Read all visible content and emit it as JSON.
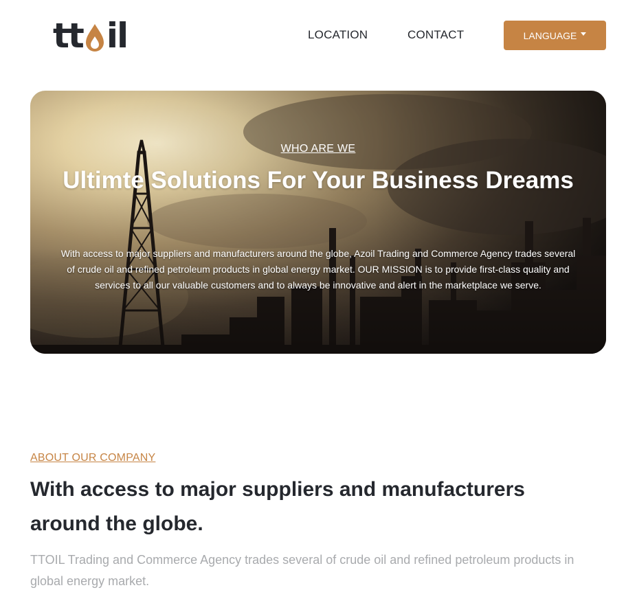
{
  "header": {
    "logo": {
      "text_left": "tt",
      "text_right": "il",
      "drop_icon": "oil-drop-icon"
    },
    "nav": [
      {
        "label": "LOCATION"
      },
      {
        "label": "CONTACT"
      }
    ],
    "language_button": {
      "label": "LANGUAGE"
    }
  },
  "hero": {
    "eyebrow": "WHO ARE WE",
    "title": "Ultimte Solutions For Your Business Dreams",
    "text": "With access to major suppliers and manufacturers around the globe, Azoil Trading and Commerce Agency trades several of crude oil and refined petroleum products in global energy market. OUR MISSION is to provide first-class quality and services to all our valuable customers and to always be innovative and alert in the marketplace we serve."
  },
  "about": {
    "eyebrow": "ABOUT OUR COMPANY",
    "title": "With access to major suppliers and manufacturers around the globe.",
    "text": "TTOIL Trading and Commerce Agency trades several of crude oil and refined petroleum products in global energy market."
  },
  "colors": {
    "accent": "#c68444",
    "text_dark": "#25282e",
    "text_muted": "#a8aaad"
  }
}
